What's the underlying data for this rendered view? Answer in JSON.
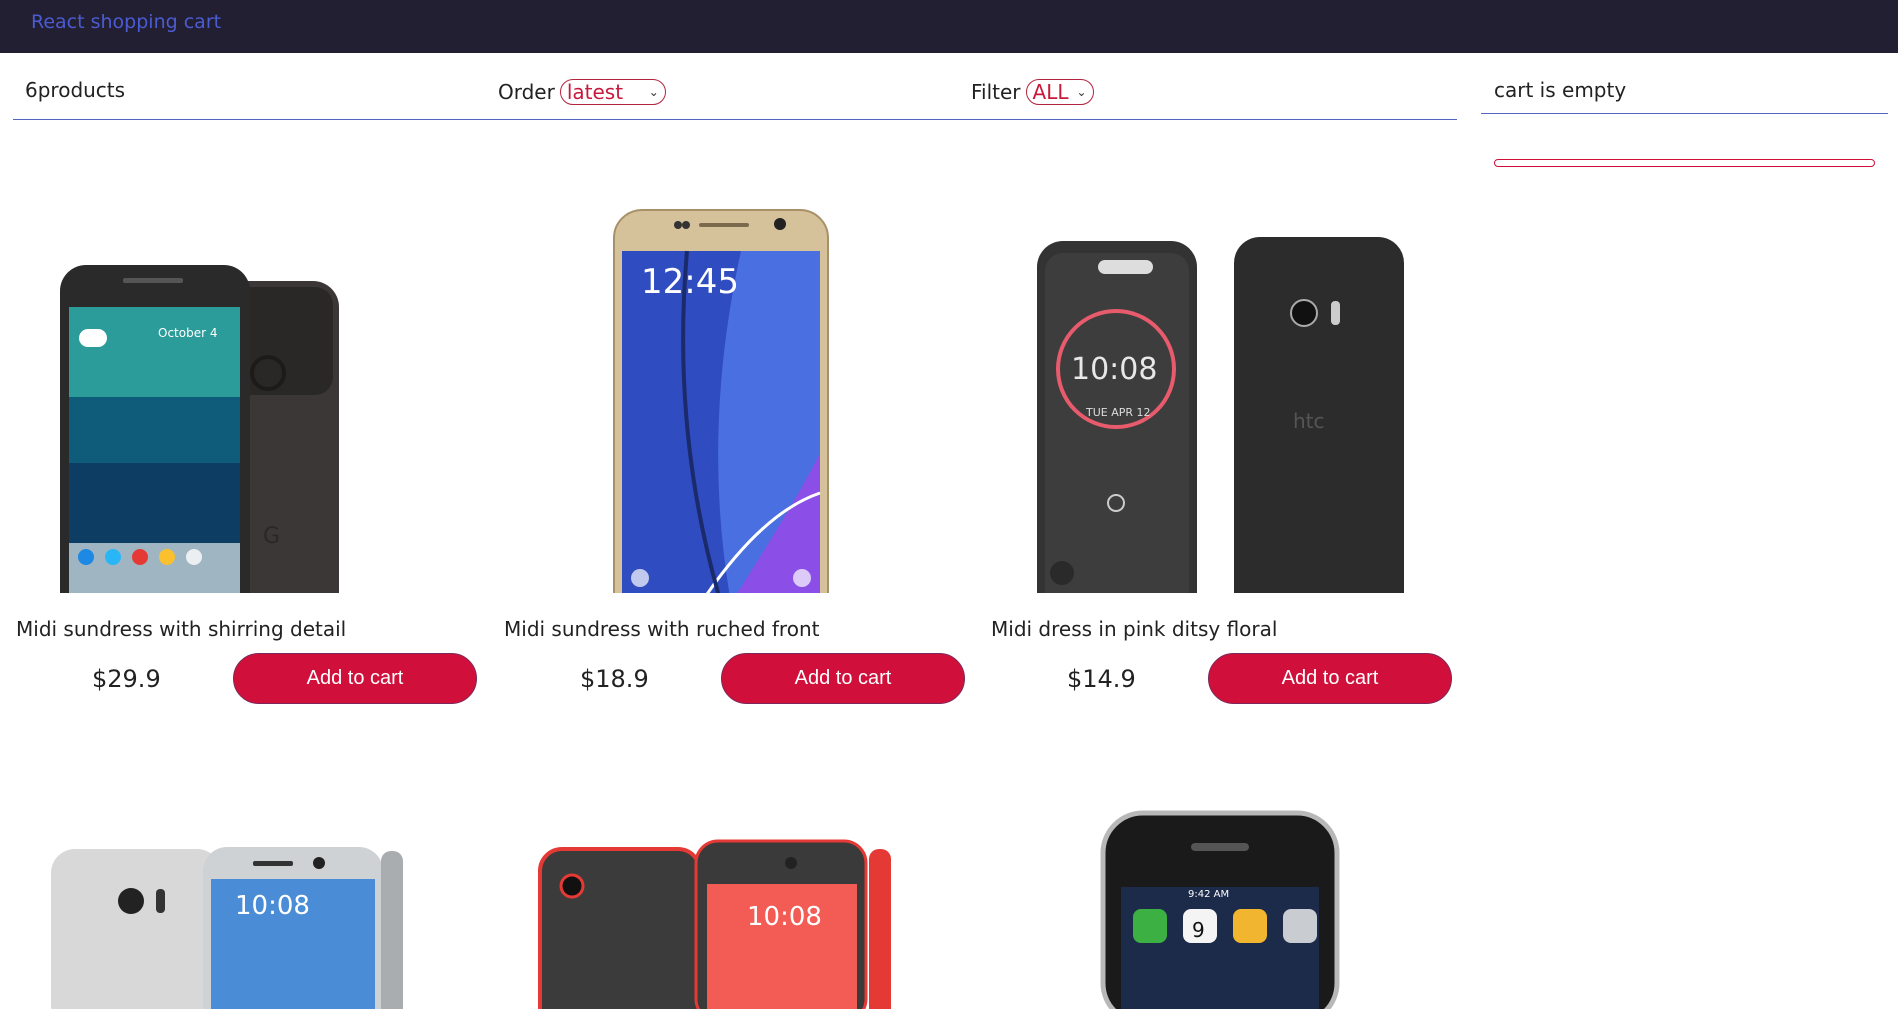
{
  "header": {
    "brand": "React shopping cart"
  },
  "filter": {
    "count_label": "6products",
    "order_label": "Order",
    "order_selected": "latest",
    "filter_label": "Filter",
    "filter_selected": "ALL"
  },
  "cart": {
    "status": "cart is empty"
  },
  "products": [
    {
      "title": "Midi sundress with shirring detail",
      "price": "$29.9",
      "button": "Add to cart",
      "image": "google-pixel-phone"
    },
    {
      "title": "Midi sundress with ruched front",
      "price": "$18.9",
      "button": "Add to cart",
      "image": "samsung-galaxy-note-phone"
    },
    {
      "title": "Midi dress in pink ditsy floral",
      "price": "$14.9",
      "button": "Add to cart",
      "image": "htc-10-with-case-phone"
    },
    {
      "title": "",
      "price": "",
      "button": "",
      "image": "htc-10-silver-phone"
    },
    {
      "title": "",
      "price": "",
      "button": "",
      "image": "htc-desire-red-phone"
    },
    {
      "title": "",
      "price": "",
      "button": "",
      "image": "iphone-original-phone"
    }
  ]
}
